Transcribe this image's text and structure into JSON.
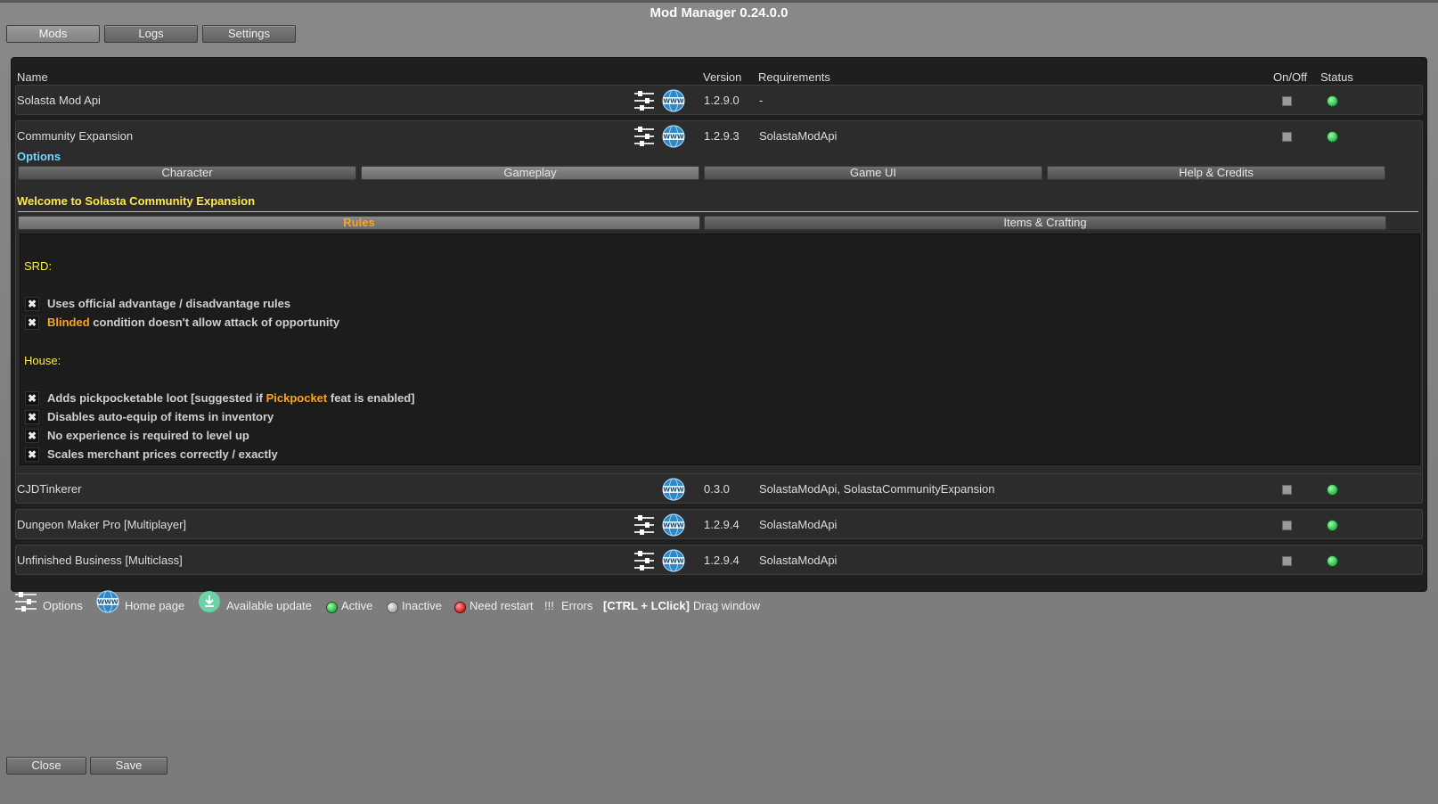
{
  "window": {
    "title": "Mod Manager 0.24.0.0"
  },
  "tabs": [
    "Mods",
    "Logs",
    "Settings"
  ],
  "columns": {
    "name": "Name",
    "version": "Version",
    "requirements": "Requirements",
    "onoff": "On/Off",
    "status": "Status"
  },
  "mods": [
    {
      "name": "Solasta Mod Api",
      "version": "1.2.9.0",
      "requirements": "-",
      "has_options": true
    },
    {
      "name": "Community Expansion",
      "version": "1.2.9.3",
      "requirements": "SolastaModApi",
      "has_options": true
    },
    {
      "name": "CJDTinkerer",
      "version": "0.3.0",
      "requirements": "SolastaModApi, SolastaCommunityExpansion",
      "has_options": false
    },
    {
      "name": "Dungeon Maker Pro [Multiplayer]",
      "version": "1.2.9.4",
      "requirements": "SolastaModApi",
      "has_options": true
    },
    {
      "name": "Unfinished Business [Multiclass]",
      "version": "1.2.9.4",
      "requirements": "SolastaModApi",
      "has_options": true
    }
  ],
  "options": {
    "label": "Options",
    "tabs": [
      "Character",
      "Gameplay",
      "Game UI",
      "Help & Credits"
    ],
    "active_tab": "Gameplay",
    "welcome": "Welcome to Solasta Community Expansion",
    "subtabs": [
      "Rules",
      "Items & Crafting"
    ],
    "active_subtab": "Rules",
    "srd_label": "SRD:",
    "srd_items": [
      {
        "pre": "",
        "hl": "",
        "post": "Uses official advantage / disadvantage rules"
      },
      {
        "pre": "",
        "hl": "Blinded",
        "post": " condition doesn't allow attack of opportunity"
      }
    ],
    "house_label": "House:",
    "house_items": [
      {
        "pre": "Adds pickpocketable loot [suggested if ",
        "hl": "Pickpocket",
        "post": " feat is enabled]"
      },
      {
        "pre": "",
        "hl": "",
        "post": "Disables auto-equip of items in inventory"
      },
      {
        "pre": "",
        "hl": "",
        "post": "No experience is required to level up"
      },
      {
        "pre": "",
        "hl": "",
        "post": "Scales merchant prices correctly / exactly"
      }
    ]
  },
  "legend": {
    "options": "Options",
    "home": "Home page",
    "update": "Available update",
    "active": "Active",
    "inactive": "Inactive",
    "restart": "Need restart",
    "errors_mark": "!!!",
    "errors": "Errors",
    "shortcut": "[CTRL + LClick]",
    "drag": "Drag window"
  },
  "footer": {
    "close": "Close",
    "save": "Save"
  },
  "colors": {
    "accent_yellow": "#ffe94a",
    "accent_orange": "#ffa31a",
    "options_cyan": "#6fd8ff",
    "active_green": "#29b54a"
  }
}
